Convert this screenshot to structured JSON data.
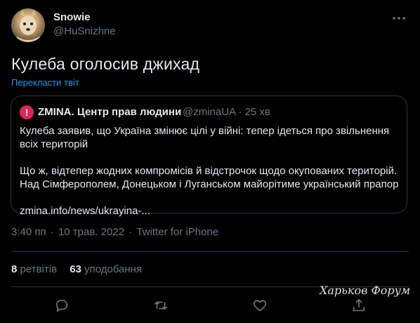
{
  "author": {
    "display_name": "Snowie",
    "handle": "@HuSnizhne"
  },
  "tweet": {
    "text": "Кулеба оголосив джихад",
    "translate_label": "Перекласти твіт"
  },
  "quote": {
    "logo_letter": "!",
    "name": "ZMINA. Центр прав людини",
    "handle_time": "@zminaUA · 25 хв",
    "para1": "Кулеба заявив, що Україна змінює цілі у війні: тепер ідеться про звільнення всіх територій",
    "para2": "Що ж, відтепер жодних компромісів й відстрочок щодо окупованих територій. Над Сімферополем, Донецьком і Луганськом майорітиме український прапор",
    "link": "zmina.info/news/ukrayina-..."
  },
  "meta": {
    "time": "3:40 пп",
    "date": "10 трав. 2022",
    "source": "Twitter for iPhone",
    "separator": "·"
  },
  "stats": {
    "retweets_count": "8",
    "retweets_label": "ретвітів",
    "likes_count": "63",
    "likes_label": "уподобання"
  },
  "watermark": "Харьков Форум",
  "colors": {
    "background": "#000000",
    "link": "#1d9bf0",
    "secondary": "#6e767d",
    "border": "#2f3336"
  },
  "icons": [
    "more-icon",
    "reply-icon",
    "retweet-icon",
    "like-icon",
    "share-icon",
    "ukraine-flag-icon"
  ]
}
